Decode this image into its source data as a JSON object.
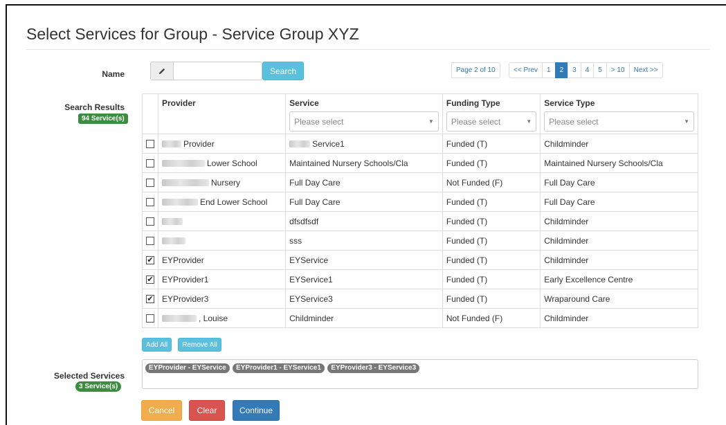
{
  "title": "Select Services for Group - Service Group XYZ",
  "name_label": "Name",
  "name_input": {
    "value": "",
    "placeholder": ""
  },
  "search_button": "Search",
  "pagination": {
    "page_info": "Page 2 of 10",
    "prev": "<< Prev",
    "pages": [
      "1",
      "2",
      "3",
      "4",
      "5"
    ],
    "active_page": "2",
    "jump": "> 10",
    "next": "Next >>"
  },
  "search_results": {
    "label": "Search Results",
    "count_badge": "94 Service(s)"
  },
  "table": {
    "columns": [
      "Provider",
      "Service",
      "Funding Type",
      "Service Type"
    ],
    "filter_placeholder": "Please select",
    "rows": [
      {
        "checked": false,
        "provider": "Provider",
        "service": "Service1",
        "funding": "Funded (T)",
        "service_type": "Childminder"
      },
      {
        "checked": false,
        "provider": "Lower School",
        "service": "Maintained Nursery Schools/Cla",
        "funding": "Funded (T)",
        "service_type": "Maintained Nursery Schools/Cla"
      },
      {
        "checked": false,
        "provider": "Nursery",
        "service": "Full Day Care",
        "funding": "Not Funded (F)",
        "service_type": "Full Day Care"
      },
      {
        "checked": false,
        "provider": "End Lower School",
        "service": "Full Day Care",
        "funding": "Funded (T)",
        "service_type": "Full Day Care"
      },
      {
        "checked": false,
        "provider": "",
        "service": "dfsdfsdf",
        "funding": "Funded (T)",
        "service_type": "Childminder"
      },
      {
        "checked": false,
        "provider": "",
        "service": "sss",
        "funding": "Funded (T)",
        "service_type": "Childminder"
      },
      {
        "checked": true,
        "provider": "EYProvider",
        "service": "EYService",
        "funding": "Funded (T)",
        "service_type": "Childminder"
      },
      {
        "checked": true,
        "provider": "EYProvider1",
        "service": "EYService1",
        "funding": "Funded (T)",
        "service_type": "Early Excellence Centre"
      },
      {
        "checked": true,
        "provider": "EYProvider3",
        "service": "EYService3",
        "funding": "Funded (T)",
        "service_type": "Wraparound Care"
      },
      {
        "checked": false,
        "provider": ", Louise",
        "service": "Childminder",
        "funding": "Not Funded (F)",
        "service_type": "Childminder"
      }
    ]
  },
  "add_all_button": "Add All",
  "remove_all_button": "Remove All",
  "selected_services": {
    "label": "Selected Services",
    "count_badge": "3 Service(s)",
    "tags": [
      "EYProvider - EYService",
      "EYProvider1 - EYService1",
      "EYProvider3 - EYService3"
    ]
  },
  "buttons": {
    "cancel": "Cancel",
    "clear": "Clear",
    "continue": "Continue"
  },
  "icons": {
    "name_addon": "pencil-icon"
  },
  "colors": {
    "primary": "#337ab7",
    "info": "#5bc0de",
    "success_badge": "#3c8d3f",
    "warning": "#f0ad4e",
    "danger": "#d9534f",
    "tag": "#777777"
  }
}
